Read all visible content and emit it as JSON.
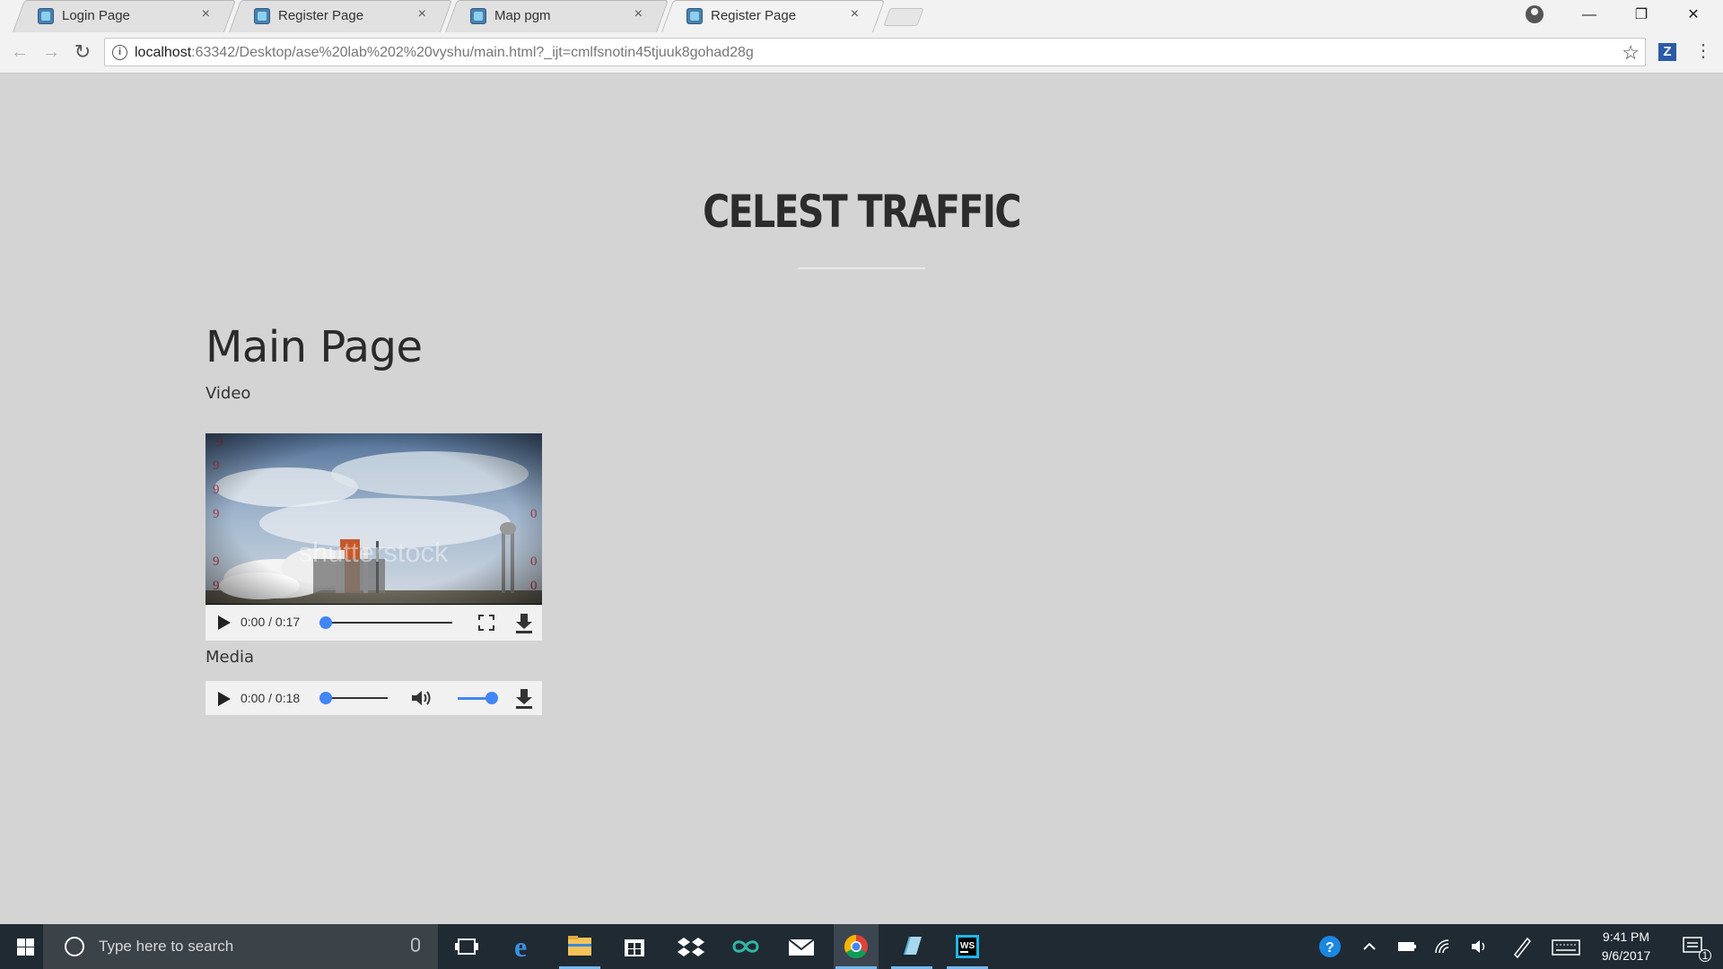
{
  "browser": {
    "tabs": [
      {
        "title": "Login Page",
        "active": false
      },
      {
        "title": "Register Page",
        "active": false
      },
      {
        "title": "Map pgm",
        "active": false
      },
      {
        "title": "Register Page",
        "active": true
      }
    ],
    "tab_close_glyph": "×",
    "url_host": "localhost",
    "url_rest": ":63342/Desktop/ase%20lab%202%20vyshu/main.html?_ijt=cmlfsnotin45tjuuk8gohad28g",
    "extension_label": "Z",
    "window_controls": {
      "minimize": "—",
      "restore": "❐",
      "close": "✕"
    },
    "nav": {
      "back": "←",
      "forward": "→",
      "reload": "↻",
      "bookmark": "☆",
      "menu": "⋮"
    }
  },
  "page": {
    "brand": "CELEST TRAFFIC",
    "title": "Main Page",
    "video_label": "Video",
    "media_label": "Media",
    "video_player": {
      "time": "0:00 / 0:17",
      "watermark": "shutterstock",
      "progress": 0.0
    },
    "audio_player": {
      "time": "0:00 / 0:18",
      "progress": 0.0,
      "volume": 1.0
    }
  },
  "taskbar": {
    "search_placeholder": "Type here to search",
    "time": "9:41 PM",
    "date": "9/6/2017",
    "notification_count": "1",
    "apps": [
      "task-view",
      "edge",
      "file-explorer",
      "store",
      "dropbox",
      "infinity",
      "mail",
      "chrome",
      "notepad",
      "webstorm"
    ],
    "accent": "#76b9ed"
  },
  "colors": {
    "page_bg": "#d4d4d4",
    "media_accent": "#4285f4"
  }
}
